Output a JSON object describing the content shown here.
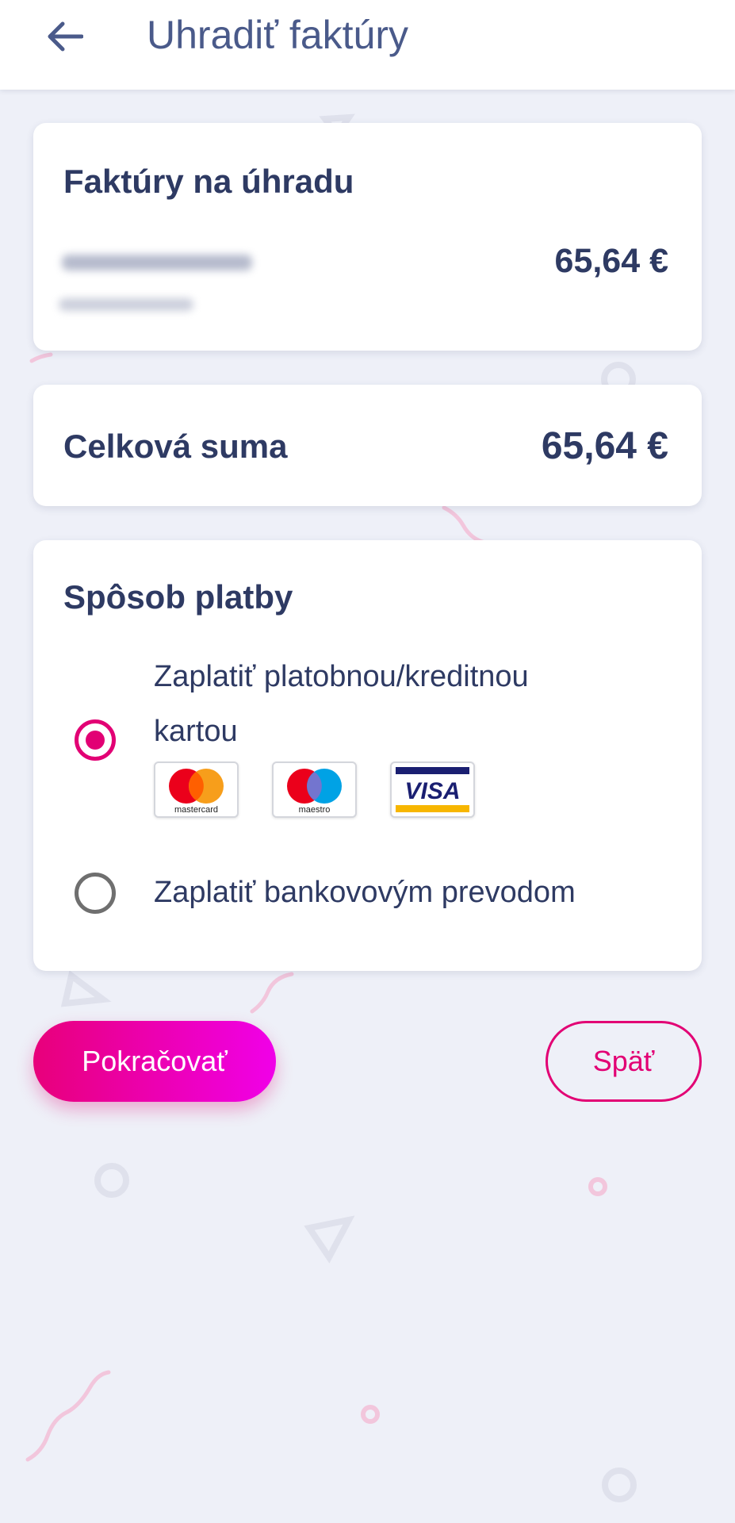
{
  "header": {
    "title": "Uhradiť faktúry",
    "back_icon": "arrow-left-icon"
  },
  "invoices": {
    "heading": "Faktúry na úhradu",
    "items": [
      {
        "amount": "65,64 €"
      }
    ]
  },
  "total": {
    "label": "Celková suma",
    "amount": "65,64 €"
  },
  "payment": {
    "heading": "Spôsob platby",
    "options": [
      {
        "label_line1": "Zaplatiť platobnou/kreditnou",
        "label_line2": "kartou",
        "selected": true
      },
      {
        "label": "Zaplatiť bankovovým prevodom",
        "selected": false
      }
    ],
    "card_logos": [
      {
        "name": "mastercard",
        "text": "mastercard"
      },
      {
        "name": "maestro",
        "text": "maestro"
      },
      {
        "name": "visa",
        "text": "VISA"
      }
    ]
  },
  "buttons": {
    "continue_label": "Pokračovať",
    "back_label": "Späť"
  },
  "colors": {
    "accent": "#e20074",
    "text_dark": "#2e3a63",
    "background": "#eef0f8"
  }
}
